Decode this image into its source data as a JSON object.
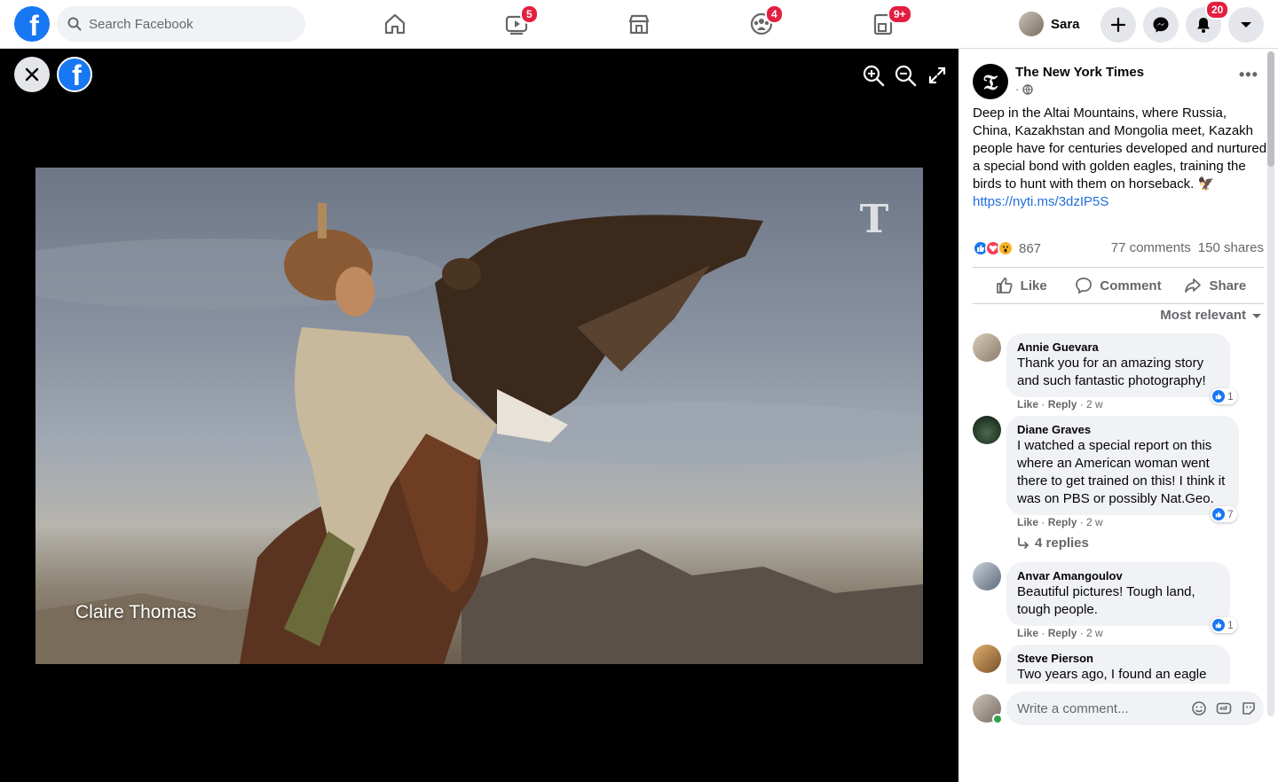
{
  "topbar": {
    "search_placeholder": "Search Facebook",
    "badges": {
      "watch": "5",
      "groups": "4",
      "gaming": "9+",
      "notifications": "20"
    },
    "profile_name": "Sara",
    "icons": [
      "home-icon",
      "watch-icon",
      "marketplace-icon",
      "groups-icon",
      "gaming-icon",
      "create-icon",
      "messenger-icon",
      "bell-icon",
      "account-dropdown-icon"
    ]
  },
  "viewer": {
    "photo_credit": "Claire Thomas",
    "watermark": "T"
  },
  "post": {
    "page_name": "The New York Times",
    "meta_separator": "·",
    "text": "Deep in the Altai Mountains, where Russia, China, Kazakhstan and Mongolia meet, Kazakh people have for centuries developed and nurtured a special bond with golden eagles, training the birds to hunt with them on horseback. 🦅 ",
    "link": "https://nyti.ms/3dzIP5S",
    "reaction_count": "867",
    "comments_count": "77 comments",
    "shares_count": "150 shares",
    "actions": {
      "like": "Like",
      "comment": "Comment",
      "share": "Share"
    },
    "sort_label": "Most relevant"
  },
  "comments": [
    {
      "name": "Annie Guevara",
      "text": "Thank you for an amazing story and such fantastic photography!",
      "like": "Like",
      "reply": "Reply",
      "time": "2 w",
      "likes": "1"
    },
    {
      "name": "Diane Graves",
      "text": "I watched a special report on this where an American woman went there to get trained on this! I think it was on PBS or possibly Nat.Geo.",
      "like": "Like",
      "reply": "Reply",
      "time": "2 w",
      "likes": "7",
      "replies": "4 replies"
    },
    {
      "name": "Anvar Amangoulov",
      "text": "Beautiful pictures! Tough land, tough people.",
      "like": "Like",
      "reply": "Reply",
      "time": "2 w",
      "likes": "1"
    },
    {
      "name": "Steve Pierson",
      "text": "Two years ago, I found an eagle"
    }
  ],
  "composer": {
    "placeholder": "Write a comment..."
  },
  "colors": {
    "brand": "#1877f2",
    "badge": "#e41e3f",
    "link": "#216fdb",
    "muted": "#65676b"
  }
}
